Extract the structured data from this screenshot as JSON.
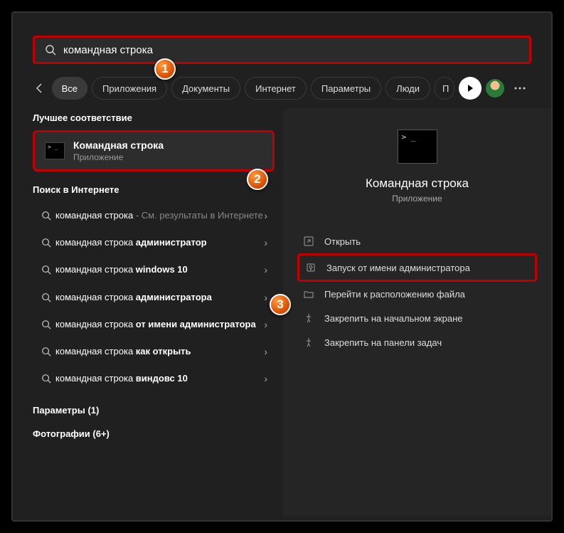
{
  "search": {
    "query": "командная строка"
  },
  "filters": {
    "all": "Все",
    "apps": "Приложения",
    "docs": "Документы",
    "web": "Интернет",
    "settings": "Параметры",
    "people": "Люди",
    "partial": "П"
  },
  "left": {
    "best_header": "Лучшее соответствие",
    "best_title": "Командная строка",
    "best_sub": "Приложение",
    "web_header": "Поиск в Интернете",
    "web_items": [
      {
        "prefix": "командная строка",
        "dim": " - См. результаты в Интернете",
        "bold": ""
      },
      {
        "prefix": "командная строка ",
        "dim": "",
        "bold": "администратор"
      },
      {
        "prefix": "командная строка ",
        "dim": "",
        "bold": "windows 10"
      },
      {
        "prefix": "командная строка ",
        "dim": "",
        "bold": "администратора"
      },
      {
        "prefix": "командная строка ",
        "dim": "",
        "bold": "от имени администратора"
      },
      {
        "prefix": "командная строка ",
        "dim": "",
        "bold": "как открыть"
      },
      {
        "prefix": "командная строка ",
        "dim": "",
        "bold": "виндовс 10"
      }
    ],
    "params_header": "Параметры (1)",
    "photos_header": "Фотографии (6+)"
  },
  "right": {
    "title": "Командная строка",
    "sub": "Приложение",
    "actions": {
      "open": "Открыть",
      "run_admin": "Запуск от имени администратора",
      "file_loc": "Перейти к расположению файла",
      "pin_start": "Закрепить на начальном экране",
      "pin_task": "Закрепить на панели задач"
    }
  },
  "badges": {
    "b1": "1",
    "b2": "2",
    "b3": "3"
  }
}
